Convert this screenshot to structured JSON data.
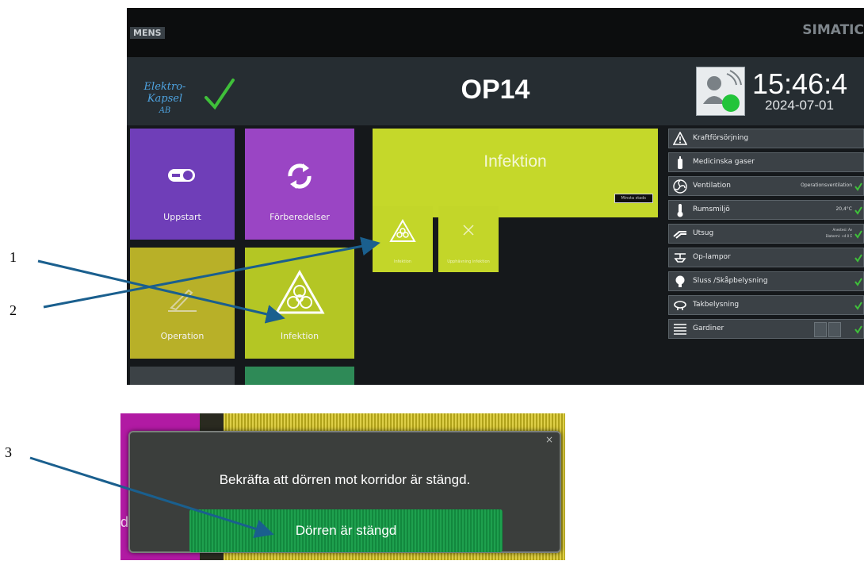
{
  "screen": {
    "brand_left": "MENS",
    "brand_right": "SIMATIC",
    "logo_line1": "Elektro-Kapsel",
    "logo_line2": "AB",
    "title": "OP14",
    "time": "15:46:4",
    "date": "2024-07-01",
    "tiles": [
      {
        "label": "Uppstart",
        "icon": "toggle-switch-icon"
      },
      {
        "label": "Förberedelser",
        "icon": "refresh-icon"
      },
      {
        "label": "Operation",
        "icon": "scalpel-icon"
      },
      {
        "label": "Infektion",
        "icon": "biohazard-icon"
      }
    ],
    "infection_panel": {
      "title": "Infektion",
      "status": "Minsta stads",
      "sub_tiles": [
        {
          "label": "Infektion",
          "icon": "biohazard-icon"
        },
        {
          "label": "Upphävning infektion",
          "icon": "close-icon"
        }
      ]
    },
    "status_rows": [
      {
        "label": "Kraftförsörjning",
        "icon": "warning-icon",
        "value": ""
      },
      {
        "label": "Medicinska gaser",
        "icon": "gas-cylinder-icon",
        "value": ""
      },
      {
        "label": "Ventilation",
        "icon": "fan-icon",
        "value": "Operationsventilation"
      },
      {
        "label": "Rumsmiljö",
        "icon": "thermometer-icon",
        "value": "20,4°C"
      },
      {
        "label": "Utsug",
        "icon": "exhaust-icon",
        "value_line1": "Anestesi: Av",
        "value_line2": "Diatermi: +4 0 Σ"
      },
      {
        "label": "Op-lampor",
        "icon": "surgical-lamp-icon",
        "value": ""
      },
      {
        "label": "Sluss /Skåpbelysning",
        "icon": "lightbulb-icon",
        "value": ""
      },
      {
        "label": "Takbelysning",
        "icon": "ceiling-light-icon",
        "value": ""
      },
      {
        "label": "Gardiner",
        "icon": "blinds-icon",
        "value": ""
      }
    ],
    "accent_colors": {
      "ok_green": "#3fbf3a",
      "infection_yellow": "#c5d82a",
      "purple": "#6f3eb8"
    }
  },
  "dialog": {
    "message": "Bekräfta att dörren mot korridor är stängd.",
    "confirm_label": "Dörren är stängd",
    "close_symbol": "×",
    "edge_text": "d"
  },
  "callouts": [
    "1",
    "2",
    "3"
  ]
}
